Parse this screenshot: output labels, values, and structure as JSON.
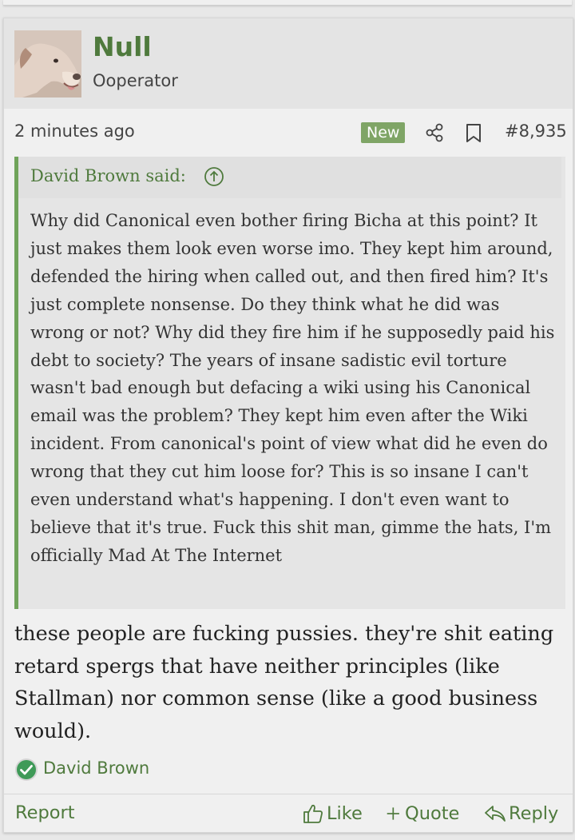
{
  "post": {
    "author": {
      "name": "Null",
      "title": "Ooperator"
    },
    "time": "2 minutes ago",
    "badge": "New",
    "number": "#8,935",
    "quote": {
      "author": "David Brown said:",
      "text": "Why did Canonical even bother firing Bicha at this point? It just makes them look even worse imo. They kept him around, defended the hiring when called out, and then fired him? It's just complete nonsense. Do they think what he did was wrong or not? Why did they fire him if he supposedly paid his debt to society? The years of insane sadistic evil torture wasn't bad enough but defacing a wiki using his Canonical email was the problem? They kept him even after the Wiki incident. From canonical's point of view what did he even do wrong that they cut him loose for? This is so insane I can't even understand what's happening. I don't even want to believe that it's true. Fuck this shit man, gimme the hats, I'm officially Mad At The Internet"
    },
    "body": "these people are fucking pussies. they're shit eating retard spergs that have neither principles (like Stallman) nor common sense (like a good business would).",
    "reaction": {
      "user": "David Brown",
      "icon": "checkmark-reaction-icon"
    },
    "actions": {
      "report": "Report",
      "like": "Like",
      "quote": "Quote",
      "reply": "Reply"
    }
  },
  "colors": {
    "accent_green": "#4f7a3d",
    "badge_green": "#7fa566",
    "quote_bar": "#6fa35a",
    "reaction_green": "#3f9a58"
  }
}
